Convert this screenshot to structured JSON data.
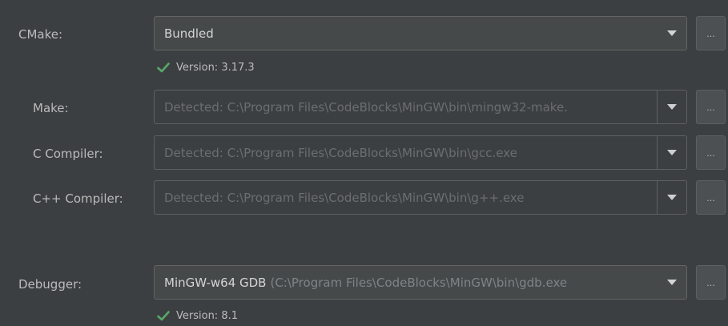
{
  "cmake": {
    "label": "CMake:",
    "value": "Bundled",
    "browse_label": "...",
    "version_text": "Version: 3.17.3"
  },
  "make": {
    "label": "Make:",
    "value": "Detected: C:\\Program Files\\CodeBlocks\\MinGW\\bin\\mingw32-make.",
    "browse_label": "..."
  },
  "c_compiler": {
    "label": "C Compiler:",
    "value": "Detected: C:\\Program Files\\CodeBlocks\\MinGW\\bin\\gcc.exe",
    "browse_label": "..."
  },
  "cpp_compiler": {
    "label": "C++ Compiler:",
    "value": "Detected: C:\\Program Files\\CodeBlocks\\MinGW\\bin\\g++.exe",
    "browse_label": "..."
  },
  "debugger": {
    "label": "Debugger:",
    "value": "MinGW-w64 GDB",
    "path": "(C:\\Program Files\\CodeBlocks\\MinGW\\bin\\gdb.exe",
    "browse_label": "...",
    "version_text": "Version: 8.1"
  },
  "colors": {
    "background": "#3c3f41",
    "check_green": "#59a869",
    "text": "#bbbbbb",
    "disabled_text": "#6b6e70"
  }
}
